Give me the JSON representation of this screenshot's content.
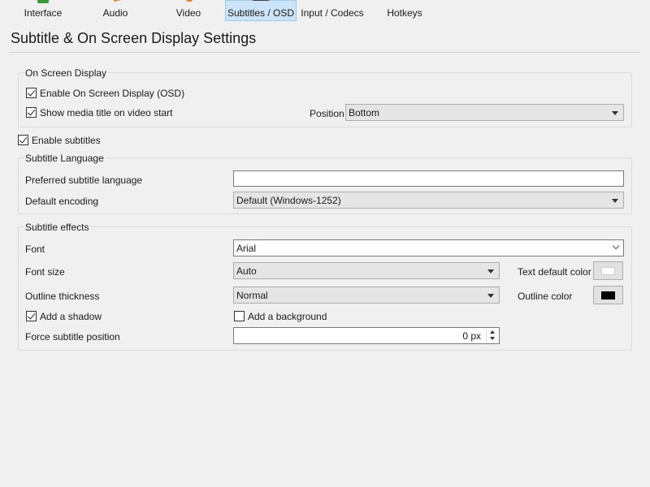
{
  "toolbar": {
    "items": [
      {
        "label": "Interface"
      },
      {
        "label": "Audio"
      },
      {
        "label": "Video"
      },
      {
        "label": "Subtitles / OSD"
      },
      {
        "label": "Input / Codecs"
      },
      {
        "label": "Hotkeys"
      }
    ],
    "active_index": 3
  },
  "page_title": "Subtitle & On Screen Display Settings",
  "osd": {
    "title": "On Screen Display",
    "enable_osd": {
      "label": "Enable On Screen Display (OSD)",
      "checked": true
    },
    "show_title": {
      "label": "Show media title on video start",
      "checked": true
    },
    "position_label": "Position",
    "position_value": "Bottom"
  },
  "enable_subtitles": {
    "label": "Enable subtitles",
    "checked": true
  },
  "language": {
    "title": "Subtitle Language",
    "preferred_label": "Preferred subtitle language",
    "preferred_value": "",
    "encoding_label": "Default encoding",
    "encoding_value": "Default (Windows-1252)"
  },
  "effects": {
    "title": "Subtitle effects",
    "font_label": "Font",
    "font_value": "Arial",
    "font_size_label": "Font size",
    "font_size_value": "Auto",
    "outline_label": "Outline thickness",
    "outline_value": "Normal",
    "shadow": {
      "label": "Add a shadow",
      "checked": true
    },
    "background": {
      "label": "Add a background",
      "checked": false
    },
    "force_pos_label": "Force subtitle position",
    "force_pos_value": "0 px",
    "text_color_label": "Text default color",
    "text_color": "#ffffff",
    "outline_color_label": "Outline color",
    "outline_color": "#000000"
  },
  "icons": [
    "interface-icon",
    "audio-icon",
    "video-icon",
    "subtitles-icon",
    "input-codecs-icon",
    "hotkeys-icon"
  ]
}
